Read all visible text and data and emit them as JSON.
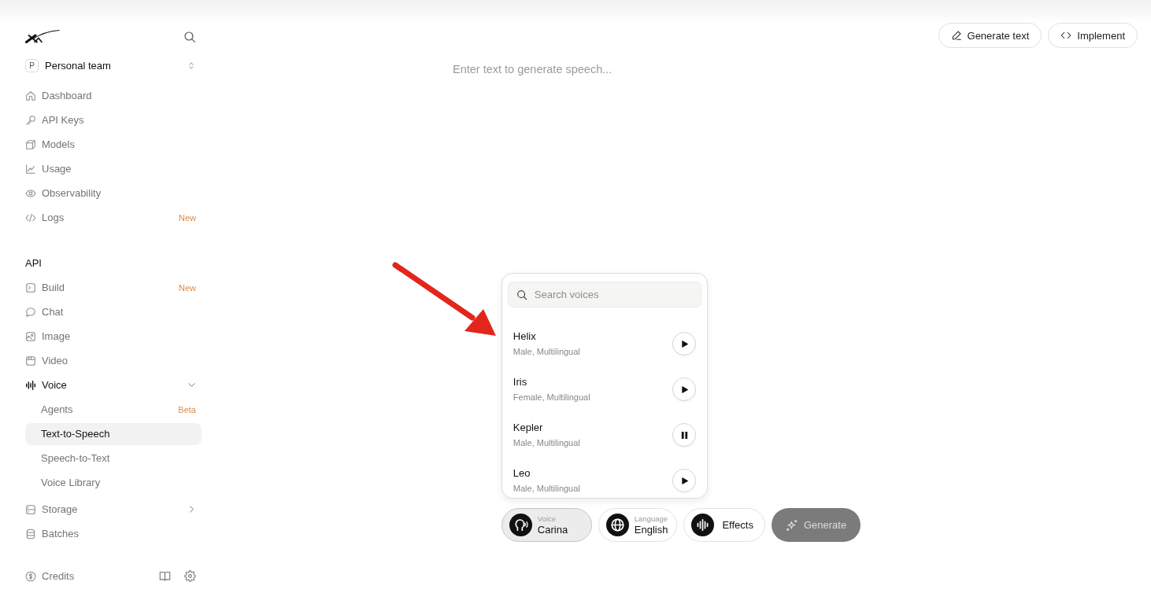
{
  "sidebar": {
    "team": {
      "initial": "P",
      "name": "Personal team"
    },
    "sections": [
      {
        "items": [
          {
            "label": "Dashboard",
            "selected": false
          },
          {
            "label": "API Keys",
            "selected": false
          },
          {
            "label": "Models",
            "selected": false
          },
          {
            "label": "Usage",
            "selected": false
          },
          {
            "label": "Observability",
            "selected": false
          },
          {
            "label": "Logs",
            "badge": "New",
            "selected": false
          }
        ]
      },
      {
        "title": "API",
        "items": [
          {
            "label": "Build",
            "badge": "New",
            "selected": false
          },
          {
            "label": "Chat",
            "selected": false
          },
          {
            "label": "Image",
            "selected": false
          },
          {
            "label": "Video",
            "selected": false
          },
          {
            "label": "Voice",
            "selected": false,
            "expanded": true,
            "children": [
              {
                "label": "Agents",
                "badge": "Beta",
                "selected": false
              },
              {
                "label": "Text-to-Speech",
                "selected": true
              },
              {
                "label": "Speech-to-Text",
                "selected": false
              },
              {
                "label": "Voice Library",
                "selected": false
              }
            ]
          },
          {
            "label": "Storage",
            "selected": false,
            "expanded": false
          },
          {
            "label": "Batches",
            "selected": false
          }
        ]
      }
    ],
    "footer": {
      "label": "Credits"
    }
  },
  "header_actions": [
    {
      "label": "Generate text"
    },
    {
      "label": "Implement"
    }
  ],
  "editor": {
    "placeholder": "Enter text to generate speech..."
  },
  "voice_menu": {
    "search": {
      "placeholder": "Search voices"
    },
    "voices": [
      {
        "name": "Helix",
        "description": "Male, Multilingual",
        "playing": false
      },
      {
        "name": "Iris",
        "description": "Female, Multilingual",
        "playing": false
      },
      {
        "name": "Kepler",
        "description": "Male, Multilingual",
        "playing": true
      },
      {
        "name": "Leo",
        "description": "Male, Multilingual",
        "playing": false
      }
    ]
  },
  "controls": [
    {
      "kind": "picker",
      "label": "Voice",
      "value": "Carina",
      "selected": true
    },
    {
      "kind": "picker",
      "label": "Language",
      "value": "English",
      "selected": false
    },
    {
      "kind": "button",
      "label": "Effects",
      "selected": false
    }
  ],
  "generate_button": {
    "label": "Generate",
    "disabled": true
  }
}
